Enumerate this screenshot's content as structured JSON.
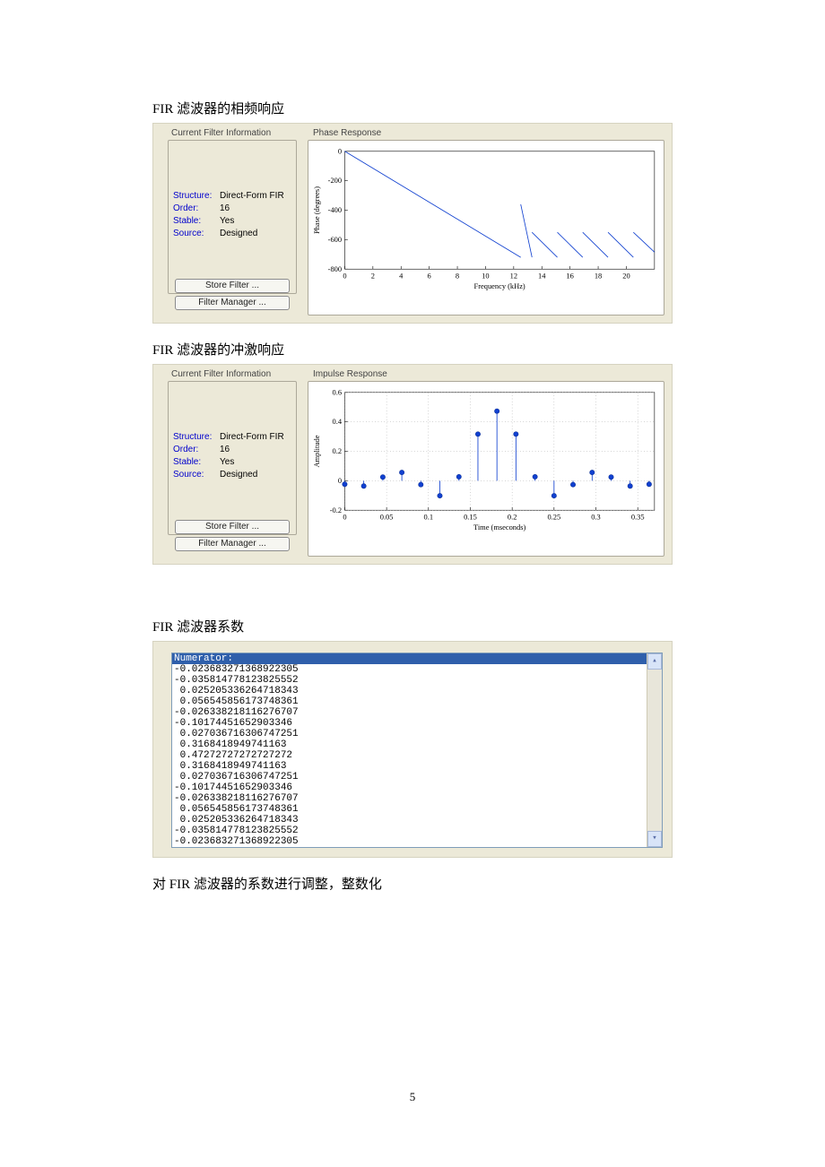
{
  "headings": {
    "h1": "FIR 滤波器的相频响应",
    "h2": "FIR 滤波器的冲激响应",
    "h3": "FIR 滤波器系数",
    "h4": "对 FIR 滤波器的系数进行调整，整数化"
  },
  "info_panel": {
    "legend": "Current Filter Information",
    "rows": [
      {
        "label": "Structure:",
        "value": "Direct-Form FIR"
      },
      {
        "label": "Order:",
        "value": "16"
      },
      {
        "label": "Stable:",
        "value": "Yes"
      },
      {
        "label": "Source:",
        "value": "Designed"
      }
    ],
    "buttons": {
      "store": "Store Filter ...",
      "manager": "Filter Manager ..."
    }
  },
  "phase_plot": {
    "legend": "Phase Response",
    "xlabel": "Frequency (kHz)",
    "ylabel": "Phase (degrees)"
  },
  "impulse_plot": {
    "legend": "Impulse Response",
    "xlabel": "Time (mseconds)",
    "ylabel": "Amplitude"
  },
  "coef_box": {
    "header": "Numerator:",
    "lines": [
      "-0.023683271368922305",
      "-0.035814778123825552",
      " 0.025205336264718343",
      " 0.056545856173748361",
      "-0.026338218116276707",
      "-0.10174451652903346",
      " 0.027036716306747251",
      " 0.3168418949741163",
      " 0.47272727272727272",
      " 0.3168418949741163",
      " 0.027036716306747251",
      "-0.10174451652903346",
      "-0.026338218116276707",
      " 0.056545856173748361",
      " 0.025205336264718343",
      "-0.035814778123825552",
      "-0.023683271368922305"
    ]
  },
  "page_number": "5",
  "chart_data": [
    {
      "type": "line",
      "title": "Phase Response",
      "xlabel": "Frequency (kHz)",
      "ylabel": "Phase (degrees)",
      "xlim": [
        0,
        22
      ],
      "ylim": [
        -800,
        0
      ],
      "xticks": [
        0,
        2,
        4,
        6,
        8,
        10,
        12,
        14,
        16,
        18,
        20
      ],
      "yticks": [
        0,
        -200,
        -400,
        -600,
        -800
      ],
      "note": "Linear phase with wraps; repeated sawtooth-like segments from 0 down to approx -720 then reset above ~13 kHz",
      "segments": [
        {
          "x": [
            0,
            12.5
          ],
          "y": [
            0,
            -720
          ]
        },
        {
          "x": [
            12.5,
            13.3
          ],
          "y": [
            -360,
            -720
          ]
        },
        {
          "x": [
            13.3,
            15.1
          ],
          "y": [
            -550,
            -720
          ]
        },
        {
          "x": [
            15.1,
            16.9
          ],
          "y": [
            -550,
            -720
          ]
        },
        {
          "x": [
            16.9,
            18.7
          ],
          "y": [
            -550,
            -720
          ]
        },
        {
          "x": [
            18.7,
            20.5
          ],
          "y": [
            -550,
            -720
          ]
        },
        {
          "x": [
            20.5,
            22.0
          ],
          "y": [
            -550,
            -685
          ]
        }
      ]
    },
    {
      "type": "scatter",
      "title": "Impulse Response (stem)",
      "xlabel": "Time (mseconds)",
      "ylabel": "Amplitude",
      "xlim": [
        0,
        0.37
      ],
      "ylim": [
        -0.2,
        0.6
      ],
      "xticks": [
        0,
        0.05,
        0.1,
        0.15,
        0.2,
        0.25,
        0.3,
        0.35
      ],
      "yticks": [
        -0.2,
        0,
        0.2,
        0.4,
        0.6
      ],
      "x": [
        0.0,
        0.0227,
        0.0455,
        0.0682,
        0.0909,
        0.1136,
        0.1364,
        0.1591,
        0.1818,
        0.2045,
        0.2273,
        0.25,
        0.2727,
        0.2955,
        0.3182,
        0.3409,
        0.3636
      ],
      "y": [
        -0.0237,
        -0.0358,
        0.0252,
        0.0565,
        -0.0263,
        -0.1017,
        0.027,
        0.3168,
        0.4727,
        0.3168,
        0.027,
        -0.1017,
        -0.0263,
        0.0565,
        0.0252,
        -0.0358,
        -0.0237
      ]
    }
  ]
}
